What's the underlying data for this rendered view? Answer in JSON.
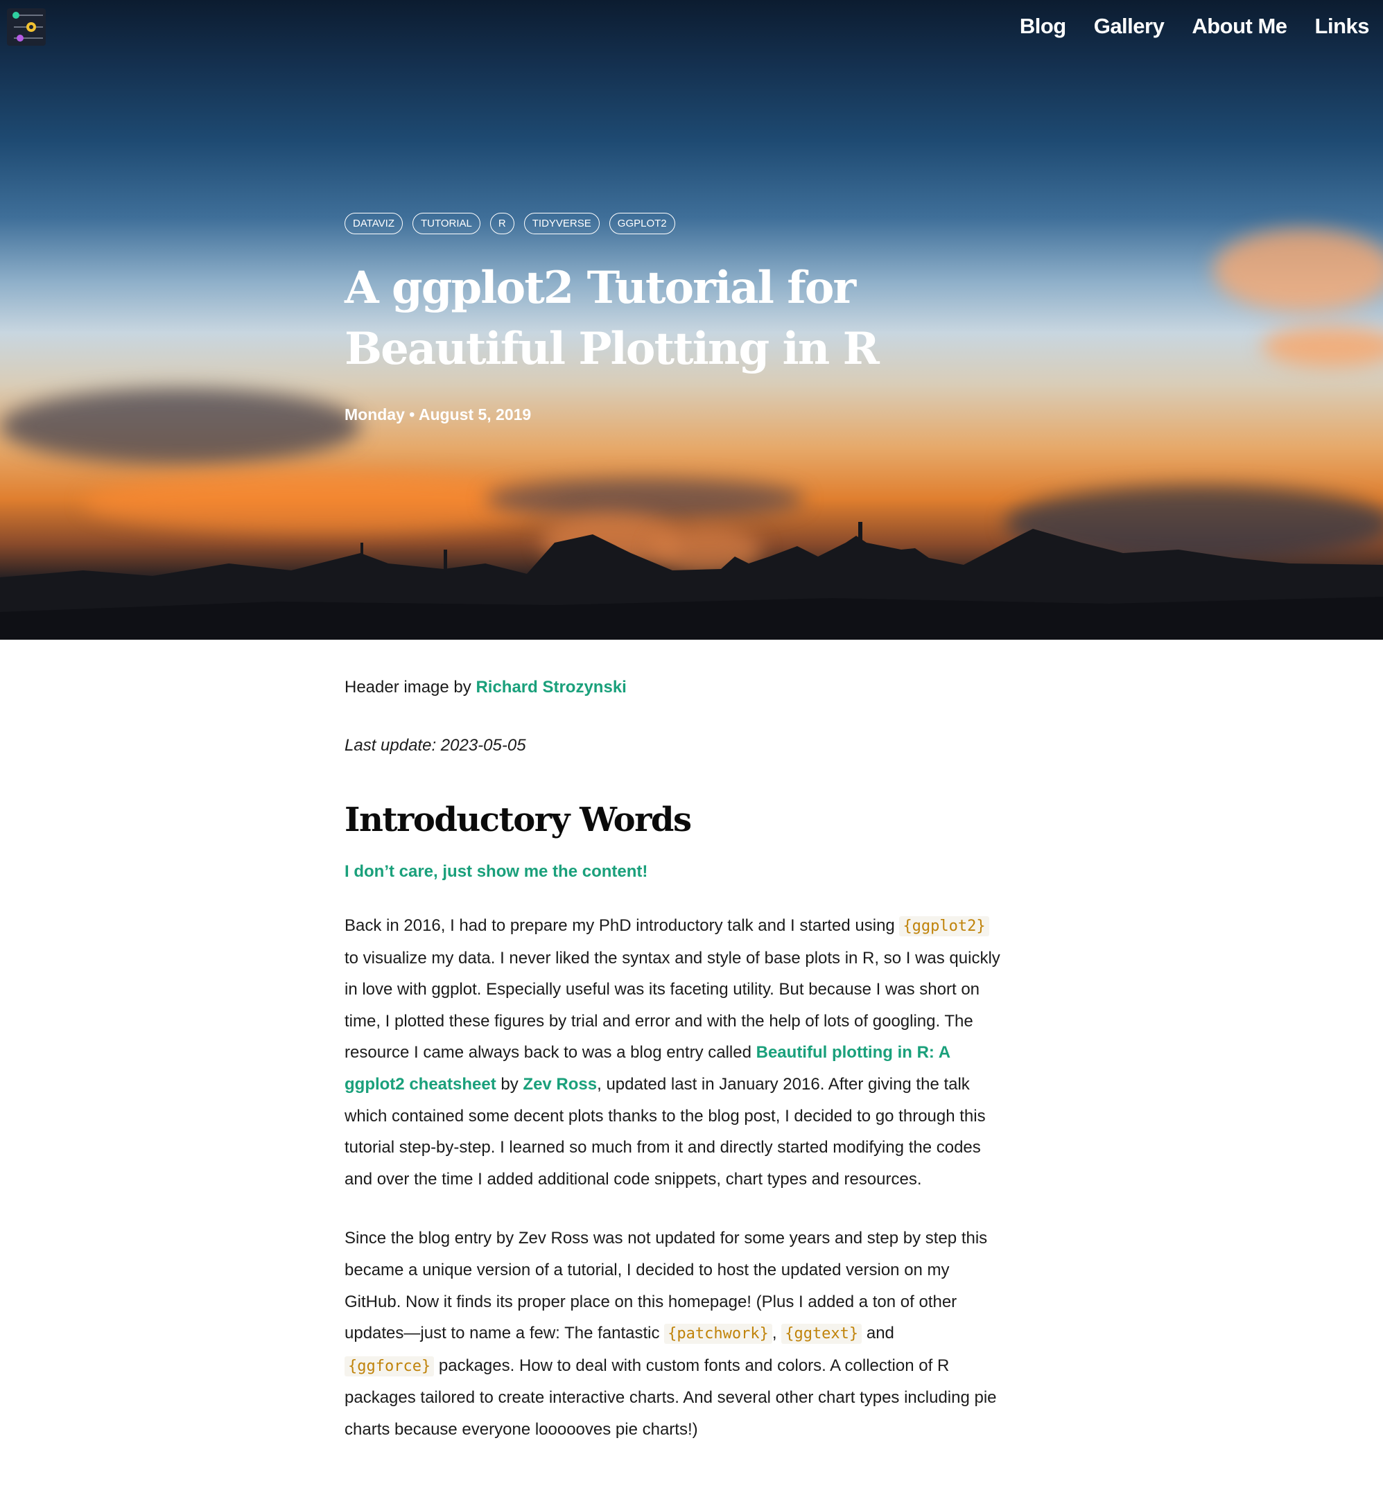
{
  "nav": {
    "items": [
      {
        "label": "Blog"
      },
      {
        "label": "Gallery"
      },
      {
        "label": "About Me"
      },
      {
        "label": "Links"
      }
    ]
  },
  "hero": {
    "tags": [
      "DATAVIZ",
      "TUTORIAL",
      "R",
      "TIDYVERSE",
      "GGPLOT2"
    ],
    "title": "A ggplot2 Tutorial for Beautiful Plotting in R",
    "date": "Monday • August 5, 2019"
  },
  "content": {
    "credit_prefix": "Header image by ",
    "credit_link": "Richard Strozynski",
    "last_update": "Last update: 2023-05-05",
    "heading": "Introductory Words",
    "skip_link": "I don’t care, just show me the content!",
    "p1": {
      "t1": "Back in 2016, I had to prepare my PhD introductory talk and I started using ",
      "code1": "{ggplot2}",
      "t2": " to visualize my data. I never liked the syntax and style of base plots in R, so I was quickly in love with ggplot. Especially useful was its faceting utility. But because I was short on time, I plotted these figures by trial and error and with the help of lots of googling. The resource I came always back to was a blog entry called ",
      "link1": "Beautiful plotting in R: A ggplot2 cheatsheet",
      "t3": " by ",
      "link2": "Zev Ross",
      "t4": ", updated last in January 2016. After giving the talk which contained some decent plots thanks to the blog post, I decided to go through this tutorial step-by-step. I learned so much from it and directly started modifying the codes and over the time I added additional code snippets, chart types and resources."
    },
    "p2": {
      "t1": "Since the blog entry by Zev Ross was not updated for some years and step by step this became a unique version of a tutorial, I decided to host the updated version on my GitHub. Now it finds its proper place on this homepage! (Plus I added a ton of other updates—just to name a few: The fantastic ",
      "code1": "{patchwork}",
      "t2": ", ",
      "code2": "{ggtext}",
      "t3": " and ",
      "code3": "{ggforce}",
      "t4": " packages. How to deal with custom fonts and colors. A collection of R packages tailored to create interactive charts. And several other chart types including pie charts because everyone loooooves pie charts!)"
    }
  }
}
